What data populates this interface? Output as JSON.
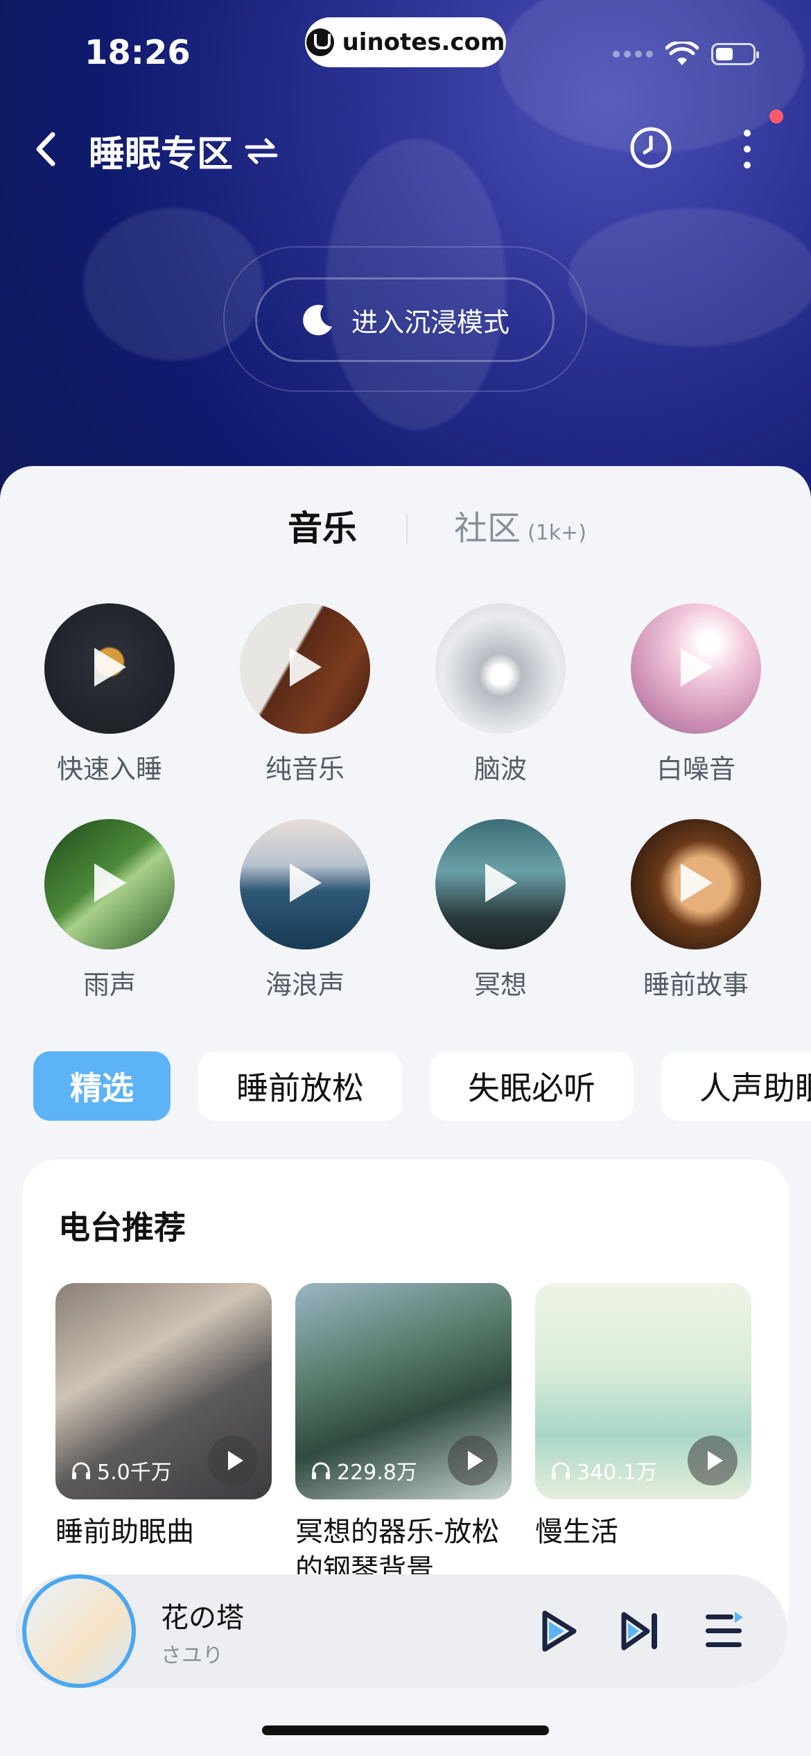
{
  "status_bar": {
    "time": "18:26",
    "brand": "uinotes.com"
  },
  "header": {
    "title": "睡眠专区"
  },
  "hero": {
    "immersive_label": "进入沉浸模式"
  },
  "tabs": {
    "music": "音乐",
    "community": "社区",
    "community_count": "(1k+)"
  },
  "categories": [
    {
      "label": "快速入睡"
    },
    {
      "label": "纯音乐"
    },
    {
      "label": "脑波"
    },
    {
      "label": "白噪音"
    },
    {
      "label": "雨声"
    },
    {
      "label": "海浪声"
    },
    {
      "label": "冥想"
    },
    {
      "label": "睡前故事"
    }
  ],
  "chips": [
    "精选",
    "睡前放松",
    "失眠必听",
    "人声助眠"
  ],
  "radio": {
    "title": "电台推荐",
    "albums": [
      {
        "name": "睡前助眠曲",
        "plays": "5.0千万"
      },
      {
        "name": "冥想的器乐-放松的钢琴背景",
        "plays": "229.8万"
      },
      {
        "name": "慢生活",
        "plays": "340.1万"
      }
    ]
  },
  "player": {
    "title": "花の塔",
    "artist": "さユり"
  },
  "colors": {
    "accent": "#5cb3f5",
    "hero": "#1a2378",
    "sheet": "#f3f5f9"
  }
}
